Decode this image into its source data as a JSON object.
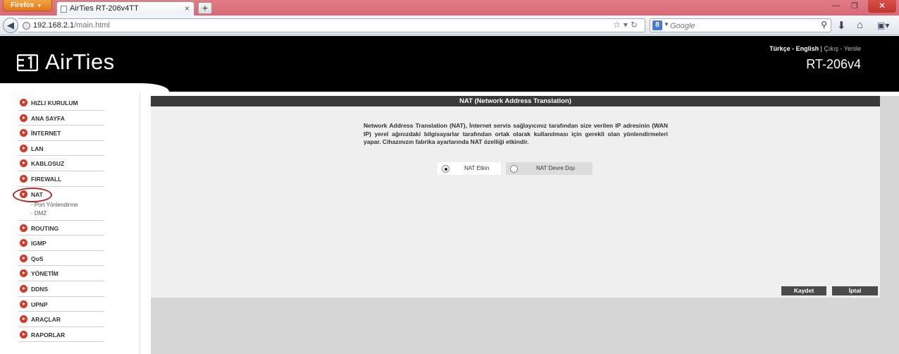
{
  "browser": {
    "menu_button": "Firefox",
    "tab_title": "AirTies RT-206v4TT",
    "new_tab": "+",
    "url_host": "192.168.2.1",
    "url_path": "/main.html",
    "search_placeholder": "Google",
    "search_engine_letter": "8"
  },
  "header": {
    "logo_text": "AirTies",
    "lang_tr": "Türkçe",
    "lang_sep": " - ",
    "lang_en": "English",
    "pipe": "  |  ",
    "logout": "Çıkış",
    "refresh": "Yenile",
    "model": "RT-206v4"
  },
  "sidebar": {
    "items": [
      "HIZLI KURULUM",
      "ANA SAYFA",
      "İNTERNET",
      "LAN",
      "KABLOSUZ",
      "FIREWALL"
    ],
    "nat": {
      "label": "NAT",
      "sub": [
        "- Port Yönlendirme",
        "- DMZ"
      ]
    },
    "items_after": [
      "ROUTING",
      "IGMP",
      "QoS",
      "YÖNETİM",
      "DDNS",
      "UPNP",
      "ARAÇLAR",
      "RAPORLAR"
    ]
  },
  "panel": {
    "title": "NAT (Network Address Translation)",
    "description": "Network Address Translation (NAT), İnternet servis sağlayıcınız tarafından size verilen IP adresinin (WAN IP) yerel ağınızdaki bilgisayarlar tarafından ortak olarak kullanılması için gerekli olan yönlendirmeleri yapar. Cihazınızın fabrika ayarlarında NAT özelliği etkindir.",
    "option_enabled": "NAT Etkin",
    "option_disabled": "NAT Devre Dışı",
    "selected": "NAT Etkin",
    "save": "Kaydet",
    "cancel": "İptal"
  }
}
